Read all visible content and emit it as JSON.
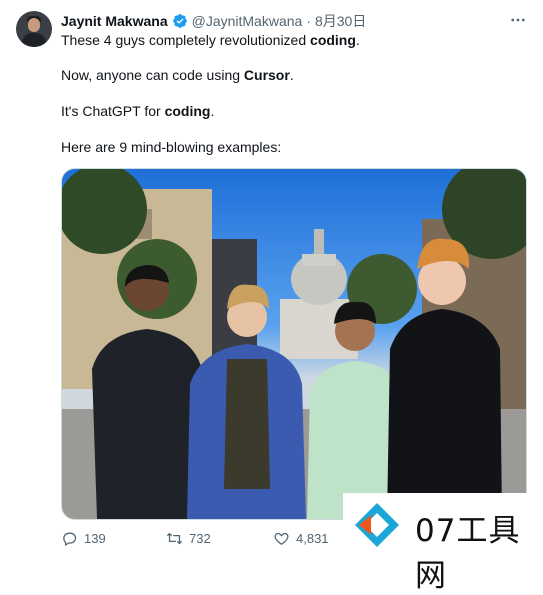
{
  "author": {
    "name": "Jaynit Makwana",
    "handle": "@JaynitMakwana",
    "separator": "·",
    "date": "8月30日"
  },
  "tweet": {
    "line1": {
      "pre": "These 4 guys completely revolutionized ",
      "bold": "coding",
      "post": "."
    },
    "line2": {
      "pre": "Now, anyone can code using ",
      "bold": "Cursor",
      "post": "."
    },
    "line3": {
      "pre": "It's ChatGPT for ",
      "bold": "coding",
      "post": "."
    },
    "line4": "Here are 9 mind-blowing examples:"
  },
  "actions": {
    "replies": "139",
    "reposts": "732",
    "likes": "4,831"
  },
  "watermark": {
    "text": "07工具网"
  },
  "colors": {
    "text": "#0f1419",
    "muted": "#536471",
    "verified": "#1d9bf0"
  },
  "icons": [
    "verified-badge-icon",
    "more-icon",
    "reply-icon",
    "repost-icon",
    "like-icon",
    "watermark-logo"
  ]
}
